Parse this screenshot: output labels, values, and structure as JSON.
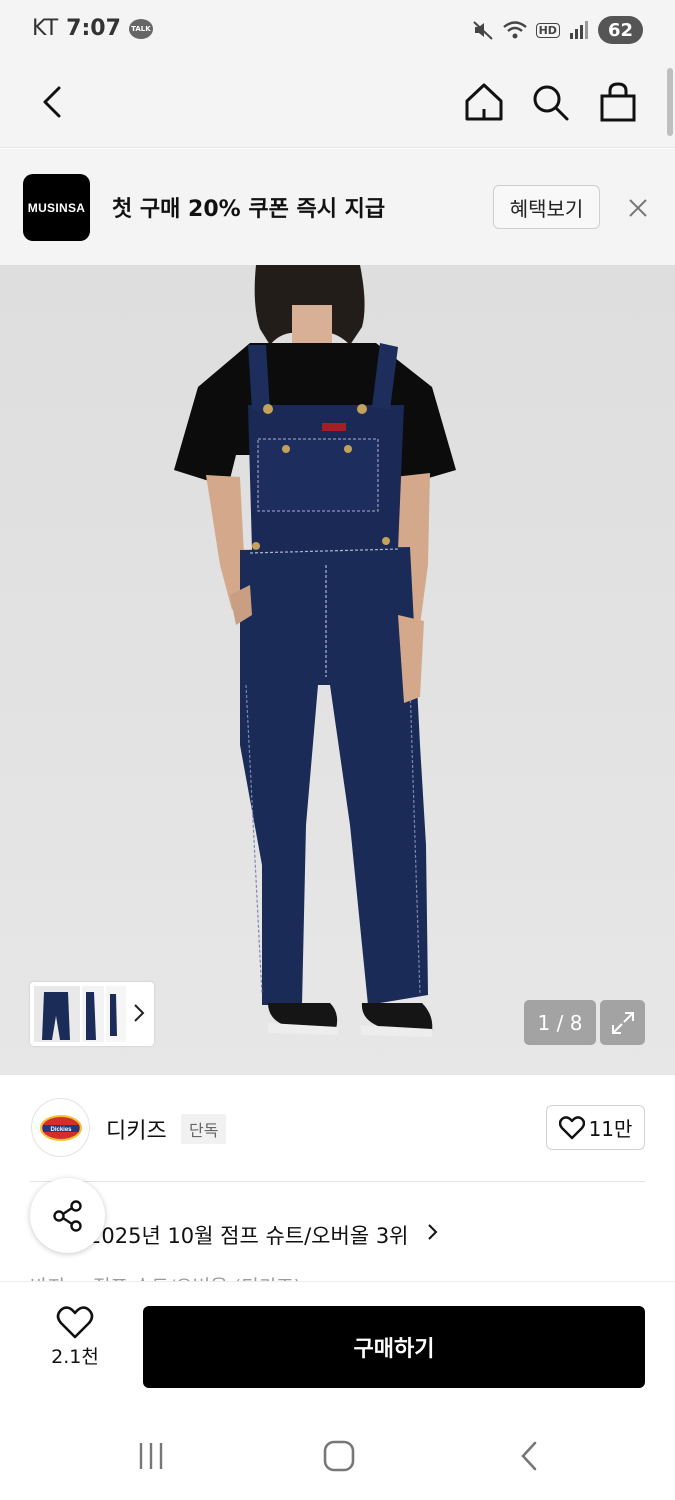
{
  "status_bar": {
    "carrier": "KT",
    "time": "7:07",
    "talk_badge": "TALK",
    "hd_label": "HD",
    "battery": "62"
  },
  "nav": {
    "back_icon": "chevron-left-icon",
    "home_icon": "home-icon",
    "search_icon": "search-icon",
    "cart_icon": "shopping-bag-icon"
  },
  "banner": {
    "logo": "MUSINSA",
    "text": "첫 구매 20% 쿠폰 즉시 지급",
    "button": "혜택보기",
    "close_icon": "close-icon"
  },
  "product_image": {
    "counter": "1 / 8",
    "expand_icon": "expand-icon",
    "thumb_chevron": "chevron-right-icon"
  },
  "brand": {
    "logo": "Dickies",
    "name": "디키즈",
    "badge": "단독",
    "likes": "11만"
  },
  "ranking": {
    "text": "2025년 10월 점프 슈트/오버올 3위",
    "share_icon": "share-icon"
  },
  "category": {
    "text": "바지 > 점프 슈트/오버올 (디키즈)"
  },
  "bottom_bar": {
    "wish_count": "2.1천",
    "buy_label": "구매하기"
  },
  "colors": {
    "background": "#f4f4f4",
    "primary": "#000000",
    "denim": "#1b2b57"
  }
}
